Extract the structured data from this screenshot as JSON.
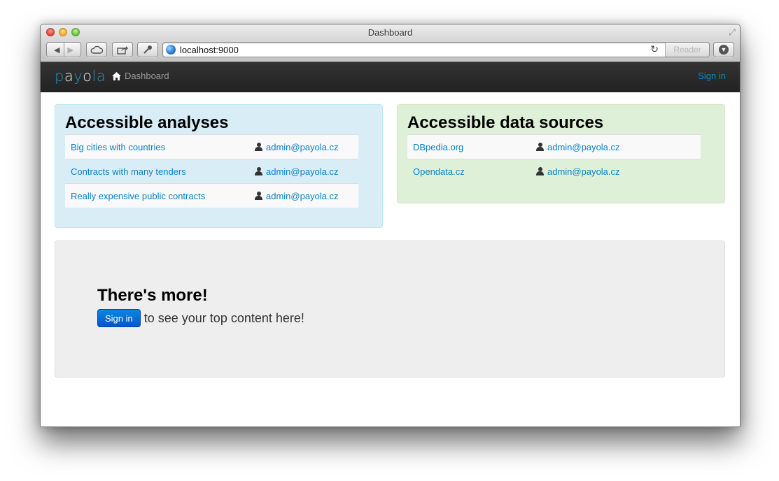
{
  "window": {
    "title": "Dashboard",
    "address": "localhost:9000",
    "reader_label": "Reader"
  },
  "navbar": {
    "logo_parts": [
      "p",
      "a",
      "y",
      "o",
      "la"
    ],
    "dashboard_label": "Dashboard",
    "signin_label": "Sign in"
  },
  "analyses": {
    "title": "Accessible analyses",
    "rows": [
      {
        "name": "Big cities with countries",
        "owner": "admin@payola.cz"
      },
      {
        "name": "Contracts with many tenders",
        "owner": "admin@payola.cz"
      },
      {
        "name": "Really expensive public contracts",
        "owner": "admin@payola.cz"
      }
    ]
  },
  "sources": {
    "title": "Accessible data sources",
    "rows": [
      {
        "name": "DBpedia.org",
        "owner": "admin@payola.cz"
      },
      {
        "name": "Opendata.cz",
        "owner": "admin@payola.cz"
      }
    ]
  },
  "hero": {
    "title": "There's more!",
    "button_label": "Sign in",
    "text": "to see your top content here!"
  },
  "icons": {
    "home": "home-icon",
    "user": "user-icon",
    "globe": "globe-icon"
  },
  "colors": {
    "link": "#0c80c5",
    "analyses_bg": "#d9edf7",
    "sources_bg": "#dff0d8",
    "hero_bg": "#eeeeee",
    "navbar_bg": "#222222",
    "primary_button": "#0066cc"
  }
}
